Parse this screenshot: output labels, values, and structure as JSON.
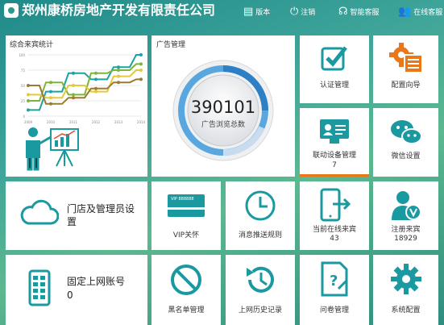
{
  "header": {
    "company": "郑州康桥房地产开发有限责任公司",
    "nav": [
      {
        "icon": "document-icon",
        "label": "版本"
      },
      {
        "icon": "power-icon",
        "label": "注销"
      },
      {
        "icon": "headset-icon",
        "label": "智能客服"
      },
      {
        "icon": "users-icon",
        "label": "在线客服"
      }
    ]
  },
  "stats_card": {
    "title": "综合来宾统计",
    "chart_data": {
      "type": "line",
      "x": [
        "2009",
        "2010",
        "2011",
        "2012",
        "2013",
        "2014"
      ],
      "ylim": [
        0,
        100
      ],
      "yticks": [
        0,
        25,
        50,
        75,
        100
      ],
      "series": [
        {
          "color": "#1aa3a3",
          "values": [
            10,
            40,
            70,
            60,
            80,
            100
          ]
        },
        {
          "color": "#7db53a",
          "values": [
            25,
            55,
            35,
            70,
            75,
            85
          ]
        },
        {
          "color": "#e6c93a",
          "values": [
            35,
            30,
            50,
            40,
            65,
            75
          ]
        },
        {
          "color": "#9b7b30",
          "values": [
            50,
            20,
            30,
            45,
            55,
            60
          ]
        }
      ]
    }
  },
  "ad_card": {
    "title": "广告管理",
    "value": "390101",
    "caption": "广告浏览总数"
  },
  "tiles": {
    "cert": {
      "label": "认证管理"
    },
    "config_wizard": {
      "label": "配置向导"
    },
    "device": {
      "label": "联动设备管理",
      "count": "7"
    },
    "wechat": {
      "label": "微信设置"
    },
    "store_admin": {
      "label": "门店及管理员设置"
    },
    "vip": {
      "label": "VIP关怀",
      "card_text": "VIP 888888"
    },
    "push": {
      "label": "消息推送规则"
    },
    "online_guests": {
      "label": "当前在线来宾",
      "count": "43"
    },
    "registered": {
      "label": "注册来宾",
      "count": "18929"
    },
    "fixed_account": {
      "label": "固定上网账号",
      "count": "0"
    },
    "blacklist": {
      "label": "黑名单管理"
    },
    "history": {
      "label": "上网历史记录"
    },
    "survey": {
      "label": "问卷管理"
    },
    "sys_config": {
      "label": "系统配置"
    }
  }
}
